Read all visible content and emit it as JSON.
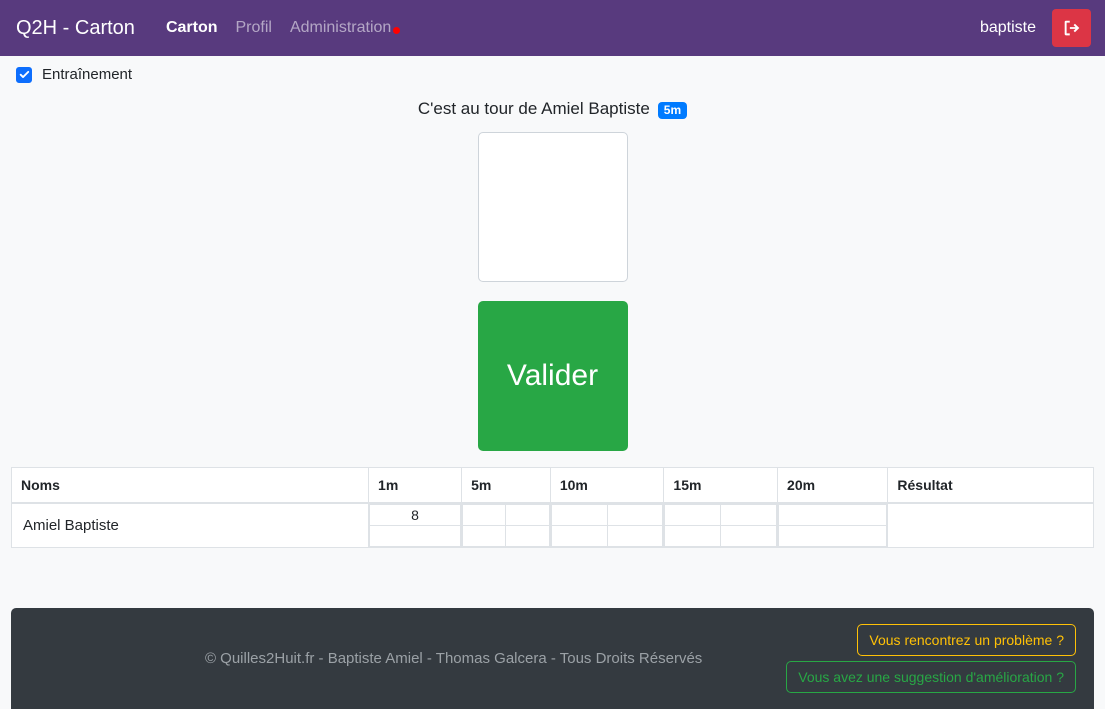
{
  "navbar": {
    "brand": "Q2H - Carton",
    "links": [
      {
        "label": "Carton",
        "active": true
      },
      {
        "label": "Profil",
        "active": false
      },
      {
        "label": "Administration",
        "active": false,
        "dot": true
      }
    ],
    "user": "baptiste",
    "logout_icon": "sign-out-icon",
    "colors": {
      "background": "#583a7e",
      "logout": "#dc3545",
      "dot": "#ff0000"
    }
  },
  "training": {
    "label": "Entraînement",
    "checked": true,
    "checkbox_color": "#0d6efd"
  },
  "main": {
    "turn_text": "C'est au tour de Amiel Baptiste",
    "turn_badge": "5m",
    "badge_color": "#007bff",
    "score_input_value": "",
    "validate_label": "Valider",
    "validate_color": "#28a745"
  },
  "table": {
    "headers": [
      "Noms",
      "1m",
      "5m",
      "10m",
      "15m",
      "20m",
      "Résultat"
    ],
    "rows": [
      {
        "name": "Amiel Baptiste",
        "slots": {
          "1m": [
            [
              "8"
            ],
            [
              ""
            ]
          ],
          "5m": [
            [
              "",
              ""
            ],
            [
              "",
              ""
            ]
          ],
          "10m": [
            [
              "",
              ""
            ],
            [
              "",
              ""
            ]
          ],
          "15m": [
            [
              "",
              ""
            ],
            [
              "",
              ""
            ]
          ],
          "20m": [
            [
              ""
            ],
            [
              ""
            ]
          ]
        },
        "result": ""
      }
    ]
  },
  "footer": {
    "copyright": "© Quilles2Huit.fr - Baptiste Amiel - Thomas Galcera - Tous Droits Réservés",
    "problem_button": "Vous rencontrez un problème ?",
    "suggestion_button": "Vous avez une suggestion d'amélioration ?",
    "colors": {
      "background": "#343a40",
      "warning": "#ffc107",
      "success": "#28a745"
    }
  }
}
